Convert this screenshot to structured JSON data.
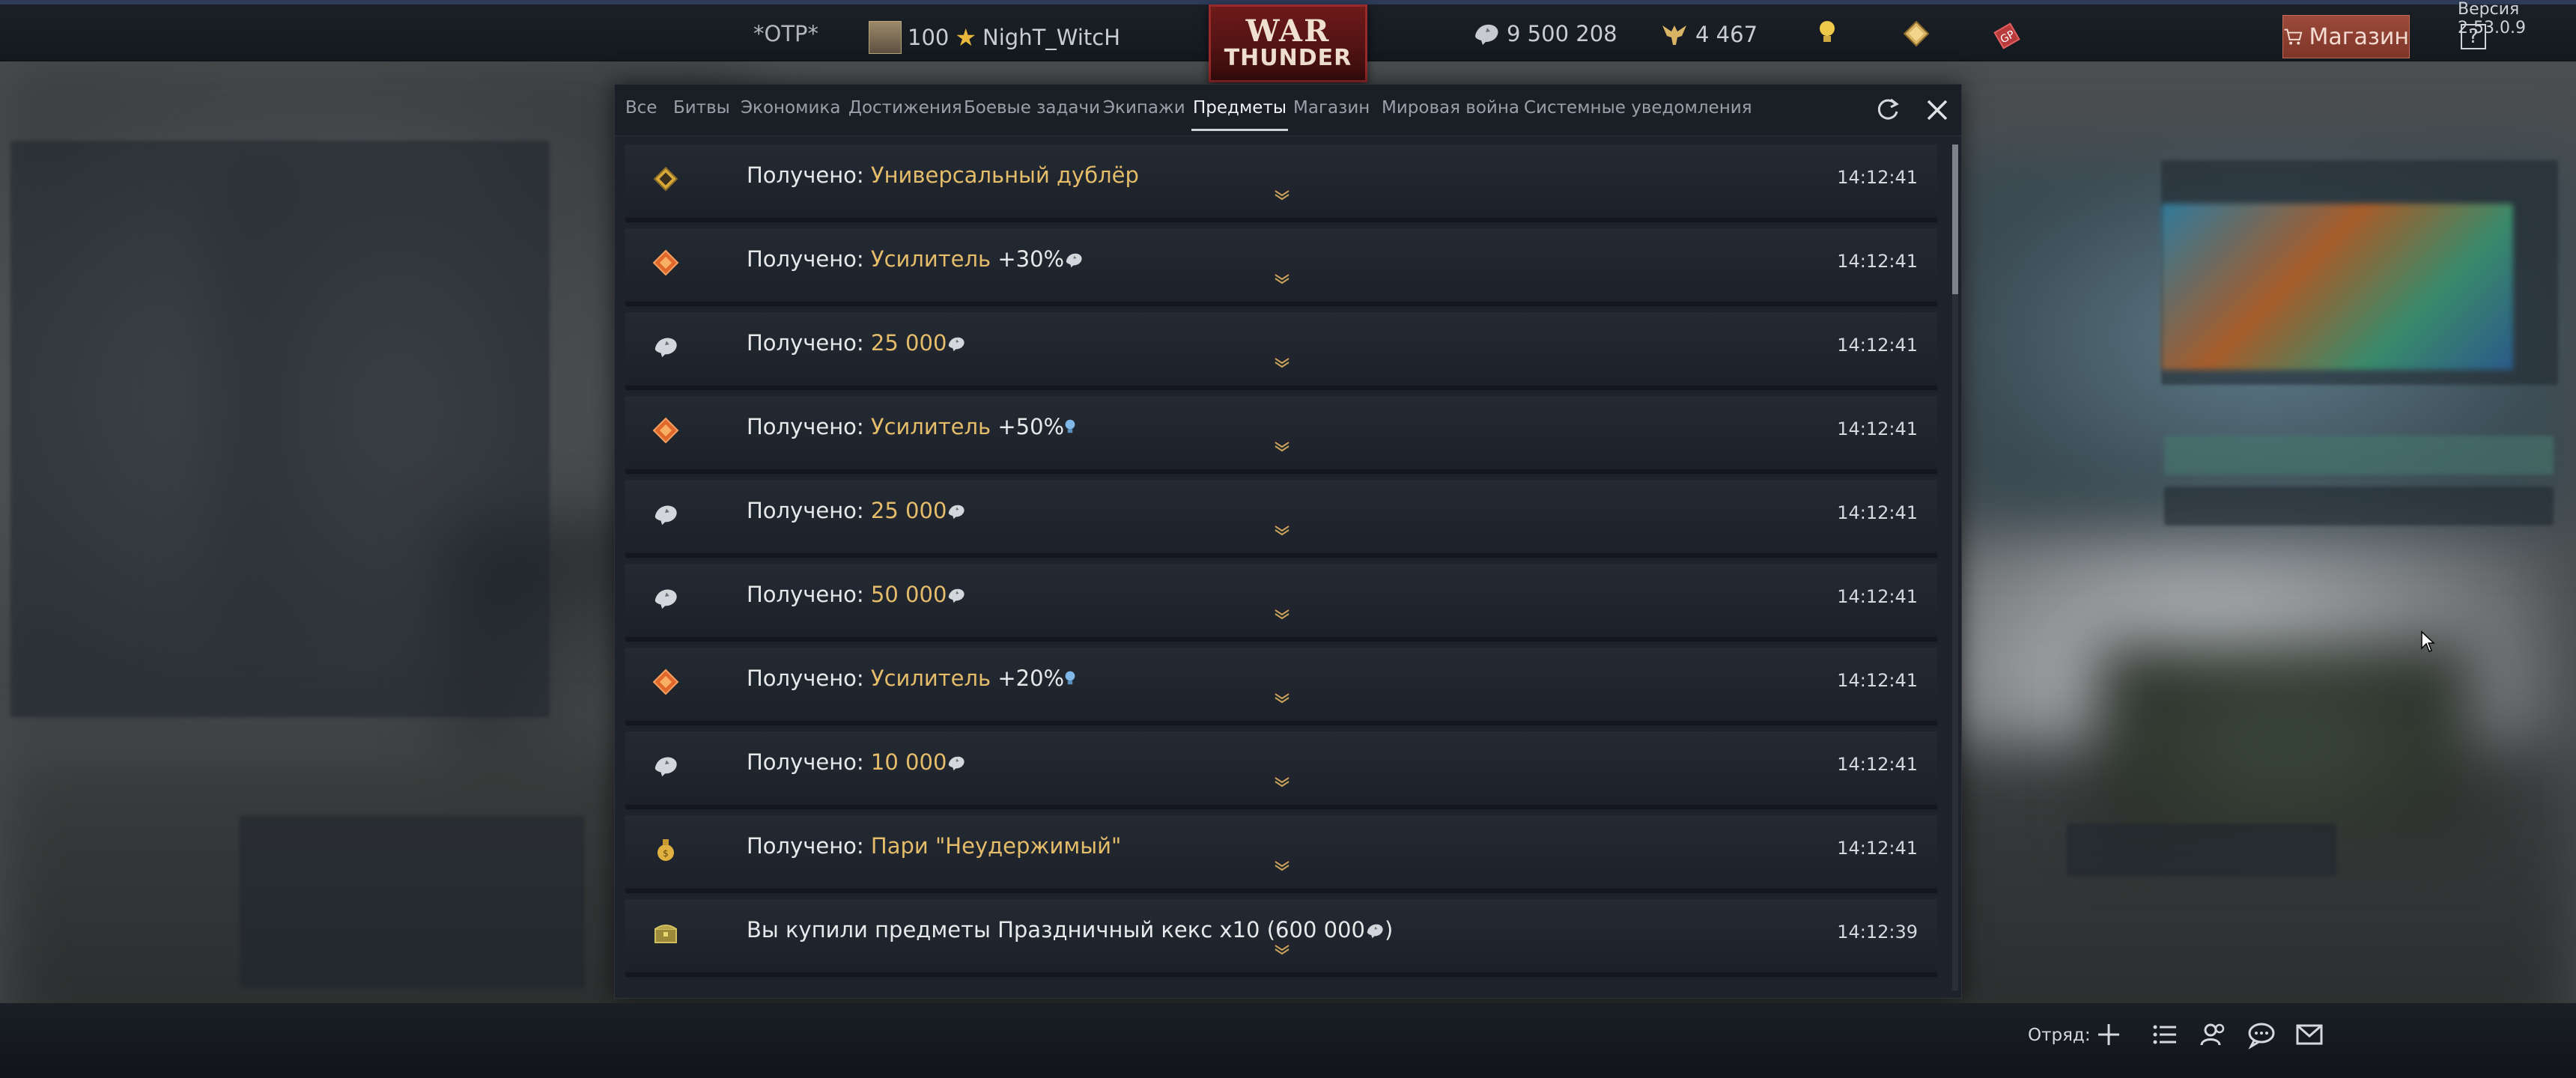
{
  "version": "Версия 2.53.0.9",
  "topbar": {
    "otp": "*OTP*",
    "player_level": "100",
    "player_name": "NighT_WitcH",
    "logo_line1": "WAR",
    "logo_line2": "THUNDER",
    "silver_lions": "9 500 208",
    "golden_eagles": "4 467",
    "shop_label": "Магазин",
    "help_label": "?"
  },
  "tabs": [
    {
      "label": "Все",
      "active": false
    },
    {
      "label": "Битвы",
      "active": false
    },
    {
      "label": "Экономика",
      "active": false
    },
    {
      "label": "Достижения",
      "active": false
    },
    {
      "label": "Боевые задачи",
      "active": false
    },
    {
      "label": "Экипажи",
      "active": false
    },
    {
      "label": "Предметы",
      "active": true
    },
    {
      "label": "Магазин",
      "active": false
    },
    {
      "label": "Мировая война",
      "active": false
    },
    {
      "label": "Системные уведомления",
      "active": false
    }
  ],
  "entries": [
    {
      "icon": "universal-backup-icon",
      "prefix": "Получено: ",
      "highlight": "Универсальный дублёр",
      "suffix": "",
      "suffix_icon": "",
      "time": "14:12:41"
    },
    {
      "icon": "booster-icon",
      "prefix": "Получено: ",
      "highlight": "Усилитель",
      "suffix": " +30%",
      "suffix_icon": "silver-lion-icon",
      "time": "14:12:41"
    },
    {
      "icon": "silver-lion-icon",
      "prefix": "Получено: ",
      "highlight": "25 000",
      "suffix": "",
      "suffix_icon": "silver-lion-icon",
      "time": "14:12:41"
    },
    {
      "icon": "booster-icon",
      "prefix": "Получено: ",
      "highlight": "Усилитель",
      "suffix": " +50%",
      "suffix_icon": "research-point-icon",
      "time": "14:12:41"
    },
    {
      "icon": "silver-lion-icon",
      "prefix": "Получено: ",
      "highlight": "25 000",
      "suffix": "",
      "suffix_icon": "silver-lion-icon",
      "time": "14:12:41"
    },
    {
      "icon": "silver-lion-icon",
      "prefix": "Получено: ",
      "highlight": "50 000",
      "suffix": "",
      "suffix_icon": "silver-lion-icon",
      "time": "14:12:41"
    },
    {
      "icon": "booster-icon",
      "prefix": "Получено: ",
      "highlight": "Усилитель",
      "suffix": " +20%",
      "suffix_icon": "research-point-icon",
      "time": "14:12:41"
    },
    {
      "icon": "silver-lion-icon",
      "prefix": "Получено: ",
      "highlight": "10 000",
      "suffix": "",
      "suffix_icon": "silver-lion-icon",
      "time": "14:12:41"
    },
    {
      "icon": "wager-icon",
      "prefix": "Получено: ",
      "highlight": "Пари \"Неудержимый\"",
      "suffix": "",
      "suffix_icon": "",
      "time": "14:12:41"
    },
    {
      "icon": "trophy-chest-icon",
      "prefix": "Вы купили предметы Праздничный кекс x10 (600 000",
      "highlight": "",
      "suffix": ")",
      "suffix_icon": "silver-lion-icon",
      "time": "14:12:39"
    }
  ],
  "bottombar": {
    "squad_label": "Отряд:"
  },
  "colors": {
    "highlight": "#e4bc6a",
    "shop_button": "#9c4a3a",
    "booster": "#e0682a",
    "topbar_accent": "#2d3a58"
  }
}
